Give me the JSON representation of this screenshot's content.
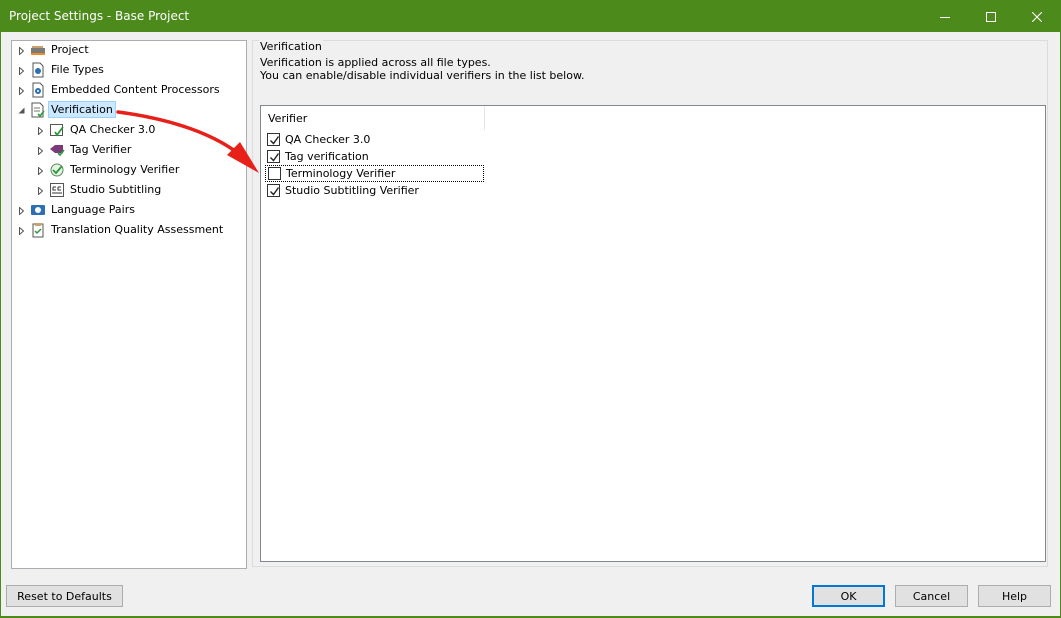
{
  "window": {
    "title": "Project Settings - Base Project",
    "titlebar_color": "#4d8a1c"
  },
  "tree": {
    "items": [
      {
        "label": "Project",
        "icon": "project-icon",
        "expanded": false
      },
      {
        "label": "File Types",
        "icon": "file-types-icon",
        "expanded": false
      },
      {
        "label": "Embedded Content Processors",
        "icon": "embedded-content-icon",
        "expanded": false
      },
      {
        "label": "Verification",
        "icon": "verification-icon",
        "expanded": true,
        "selected": true
      },
      {
        "label": "QA Checker 3.0",
        "icon": "qa-checker-icon",
        "expanded": false
      },
      {
        "label": "Tag Verifier",
        "icon": "tag-verifier-icon",
        "expanded": false
      },
      {
        "label": "Terminology Verifier",
        "icon": "terminology-verifier-icon",
        "expanded": false
      },
      {
        "label": "Studio Subtitling",
        "icon": "subtitling-icon",
        "expanded": false
      },
      {
        "label": "Language Pairs",
        "icon": "language-pairs-icon",
        "expanded": false
      },
      {
        "label": "Translation Quality Assessment",
        "icon": "tqa-icon",
        "expanded": false
      }
    ]
  },
  "panel": {
    "group_title": "Verification",
    "description_line1": "Verification is applied across all file types.",
    "description_line2": "You can enable/disable individual verifiers in the list below.",
    "list_header": "Verifier",
    "verifiers": [
      {
        "label": "QA Checker 3.0",
        "checked": true
      },
      {
        "label": "Tag verification",
        "checked": true
      },
      {
        "label": "Terminology Verifier",
        "checked": false,
        "focused": true
      },
      {
        "label": "Studio Subtitling Verifier",
        "checked": true
      }
    ]
  },
  "buttons": {
    "reset": "Reset to Defaults",
    "ok": "OK",
    "cancel": "Cancel",
    "help": "Help"
  },
  "annotation": {
    "arrow_color": "#e8201a"
  }
}
